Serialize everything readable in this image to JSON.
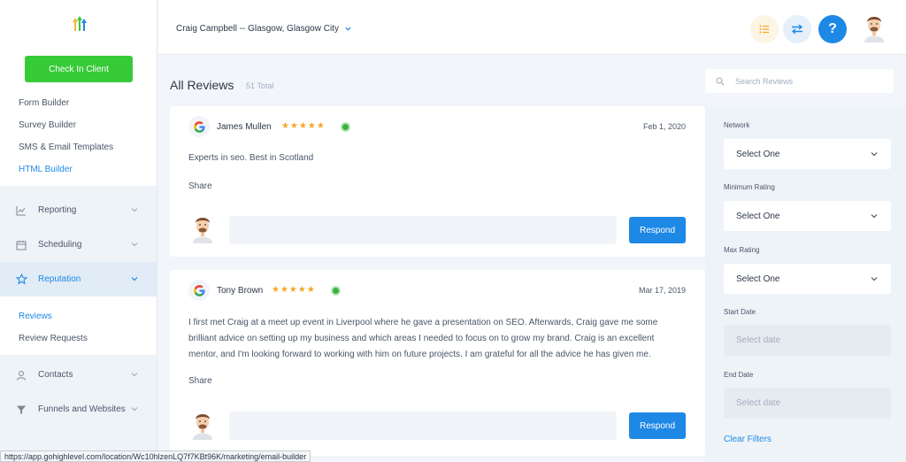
{
  "sidebar": {
    "checkin_label": "Check In Client",
    "marketing_items": [
      {
        "label": "Form Builder"
      },
      {
        "label": "Survey Builder"
      },
      {
        "label": "SMS & Email Templates"
      },
      {
        "label": "HTML Builder"
      }
    ],
    "nav": {
      "reporting": "Reporting",
      "scheduling": "Scheduling",
      "reputation": "Reputation",
      "contacts": "Contacts",
      "funnels": "Funnels and Websites"
    },
    "reputation_items": [
      {
        "label": "Reviews"
      },
      {
        "label": "Review Requests"
      }
    ]
  },
  "header": {
    "location": "Craig Campbell -- Glasgow, Glasgow City",
    "help_label": "?"
  },
  "main": {
    "title": "All Reviews",
    "total": "51 Total",
    "reviews": [
      {
        "name": "James Mullen",
        "stars": "★★★★★",
        "date": "Feb 1, 2020",
        "text": "Experts in seo. Best in Scotland",
        "share": "Share",
        "respond": "Respond"
      },
      {
        "name": "Tony Brown",
        "stars": "★★★★★",
        "date": "Mar 17, 2019",
        "text": "I first met Craig at a meet up event in Liverpool where he gave a presentation on SEO. Afterwards, Craig gave me some brilliant advice on setting up my business and which areas I needed to focus on to grow my brand. Craig is an excellent mentor, and I'm looking forward to working with him on future projects. I am grateful for all the advice he has given me.",
        "share": "Share",
        "respond": "Respond"
      }
    ]
  },
  "filters": {
    "search_placeholder": "Search Reviews",
    "network_label": "Network",
    "network_value": "Select One",
    "min_rating_label": "Minimum Rating",
    "min_rating_value": "Select One",
    "max_rating_label": "Max Rating",
    "max_rating_value": "Select One",
    "start_date_label": "Start Date",
    "start_date_placeholder": "Select date",
    "end_date_label": "End Date",
    "end_date_placeholder": "Select date",
    "clear_label": "Clear Filters"
  },
  "statusbar": {
    "url": "https://app.gohighlevel.com/location/Wc10hlzenLQ7f7KBt96K/marketing/email-builder"
  },
  "colors": {
    "accent": "#1e88e5",
    "checkin": "#37ca37",
    "stars": "#f5a623"
  }
}
